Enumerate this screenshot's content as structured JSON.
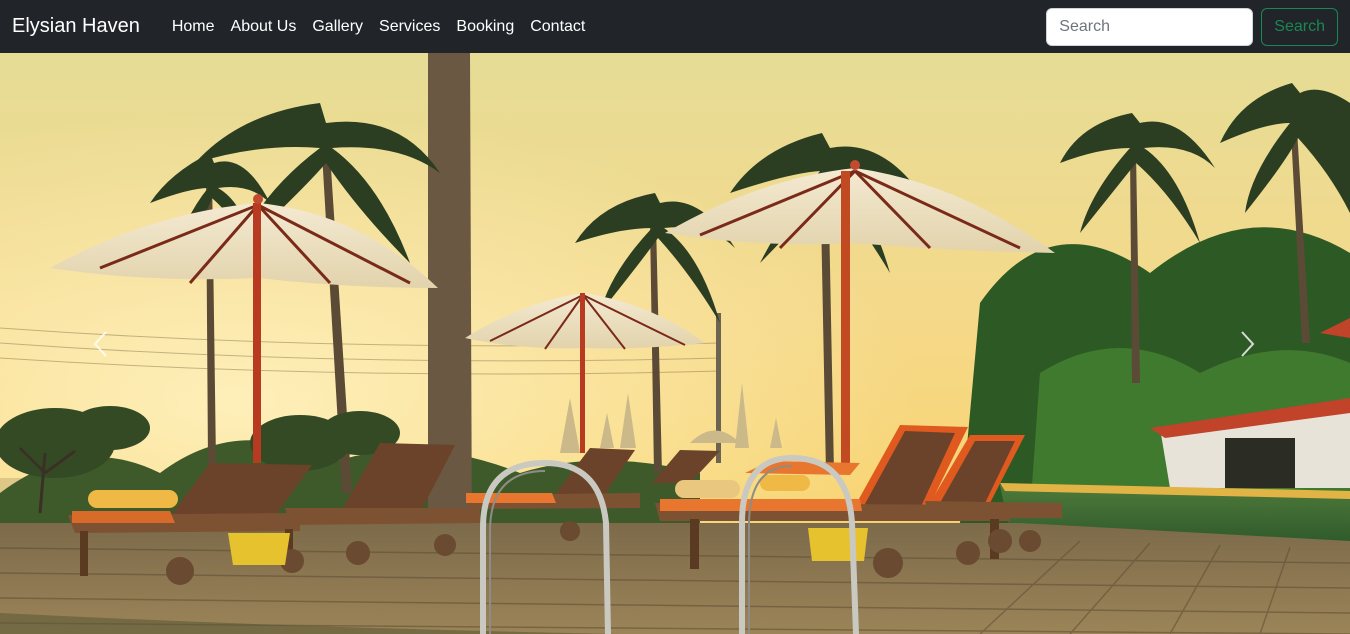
{
  "navbar": {
    "brand": "Elysian Haven",
    "links": [
      "Home",
      "About Us",
      "Gallery",
      "Services",
      "Booking",
      "Contact"
    ],
    "search": {
      "placeholder": "Search",
      "button_label": "Search"
    }
  },
  "hero": {
    "icons": {
      "prev": "chevron-left-icon",
      "next": "chevron-right-icon"
    }
  },
  "colors": {
    "navbar_bg": "#212529",
    "search_accent": "#198754"
  }
}
